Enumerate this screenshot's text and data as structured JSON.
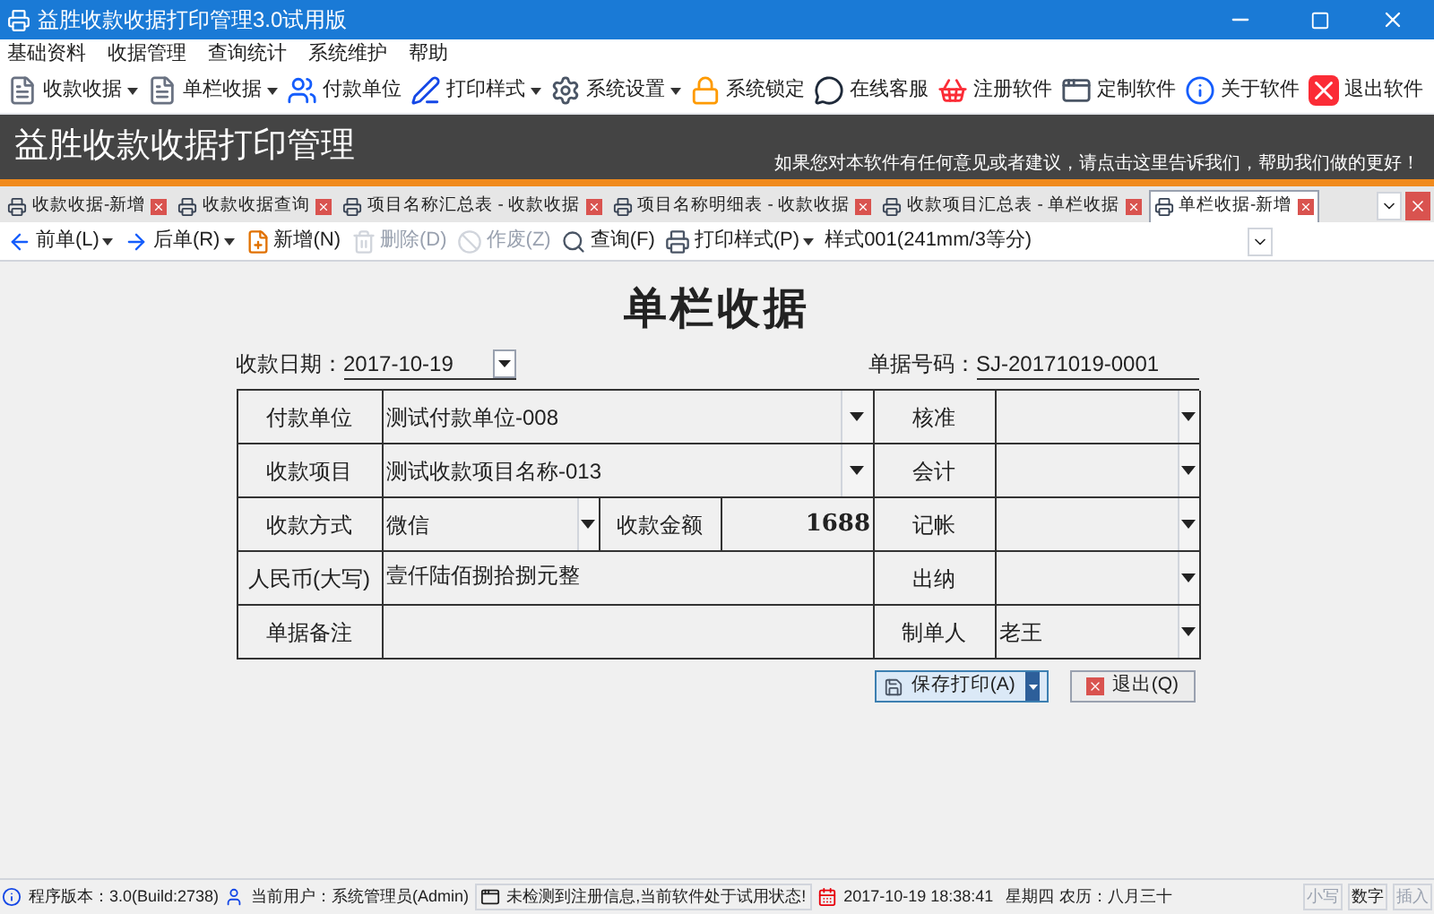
{
  "window": {
    "title": "益胜收款收据打印管理3.0试用版"
  },
  "menu": [
    "基础资料",
    "收据管理",
    "查询统计",
    "系统维护",
    "帮助"
  ],
  "toolbar": [
    {
      "label": "收款收据",
      "dropdown": true
    },
    {
      "label": "单栏收据",
      "dropdown": true
    },
    {
      "label": "付款单位",
      "dropdown": false
    },
    {
      "label": "打印样式",
      "dropdown": true
    },
    {
      "label": "系统设置",
      "dropdown": true
    },
    {
      "label": "系统锁定",
      "dropdown": false
    },
    {
      "label": "在线客服",
      "dropdown": false
    },
    {
      "label": "注册软件",
      "dropdown": false
    },
    {
      "label": "定制软件",
      "dropdown": false
    },
    {
      "label": "关于软件",
      "dropdown": false
    },
    {
      "label": "退出软件",
      "dropdown": false
    }
  ],
  "banner": {
    "title": "益胜收款收据打印管理",
    "feedback": "如果您对本软件有任何意见或者建议，请点击这里告诉我们，帮助我们做的更好！"
  },
  "tabs": [
    {
      "label": "收款收据-新增",
      "selected": false
    },
    {
      "label": "收款收据查询",
      "selected": false
    },
    {
      "label": "项目名称汇总表 - 收款收据",
      "selected": false
    },
    {
      "label": "项目名称明细表 - 收款收据",
      "selected": false
    },
    {
      "label": "收款项目汇总表 - 单栏收据",
      "selected": false
    },
    {
      "label": "单栏收据-新增",
      "selected": true
    }
  ],
  "subtoolbar": [
    {
      "label": "前单(L)",
      "kind": "nav",
      "dropdown": true,
      "disabled": false
    },
    {
      "label": "后单(R)",
      "kind": "nav",
      "dropdown": true,
      "disabled": false
    },
    {
      "label": "新增(N)",
      "kind": "new",
      "dropdown": false,
      "disabled": false
    },
    {
      "label": "删除(D)",
      "kind": "delete",
      "dropdown": false,
      "disabled": true
    },
    {
      "label": "作废(Z)",
      "kind": "void",
      "dropdown": false,
      "disabled": true
    },
    {
      "label": "查询(F)",
      "kind": "search",
      "dropdown": false,
      "disabled": false
    },
    {
      "label": "打印样式(P)",
      "kind": "print",
      "dropdown": true,
      "disabled": false
    }
  ],
  "style_select": {
    "value": "样式001(241mm/3等分)"
  },
  "form": {
    "title": "单栏收据",
    "date_label": "收款日期：",
    "date": "2017-10-19",
    "number_label": "单据号码：",
    "number": "SJ-20171019-0001",
    "payer_label": "付款单位",
    "payer": "测试付款单位-008",
    "item_label": "收款项目",
    "item": "测试收款项目名称-013",
    "method_label": "收款方式",
    "method": "微信",
    "amount_label": "收款金额",
    "amount": "1688",
    "rmb_label": "人民币(大写)",
    "rmb": "壹仟陆佰捌拾捌元整",
    "note_label": "单据备注",
    "signers": [
      {
        "label": "核准"
      },
      {
        "label": "会计"
      },
      {
        "label": "记帐"
      },
      {
        "label": "出纳"
      },
      {
        "label": "制单人",
        "value": "老王"
      }
    ],
    "buttons": [
      {
        "label": "保存打印(A)",
        "kind": "save"
      },
      {
        "label": "退出(Q)",
        "kind": "exit"
      }
    ]
  },
  "status_bar": {
    "version": "程序版本：3.0(Build:2738)",
    "user": "当前用户：系统管理员(Admin)",
    "notice": "未检测到注册信息,当前软件处于试用状态!",
    "datetime": "2017-10-19 18:38:41",
    "weekday": "星期四",
    "lunar": "农历：八月三十",
    "keys": [
      {
        "label": "小写",
        "on": false
      },
      {
        "label": "数字",
        "on": true
      },
      {
        "label": "插入",
        "on": false
      }
    ]
  }
}
